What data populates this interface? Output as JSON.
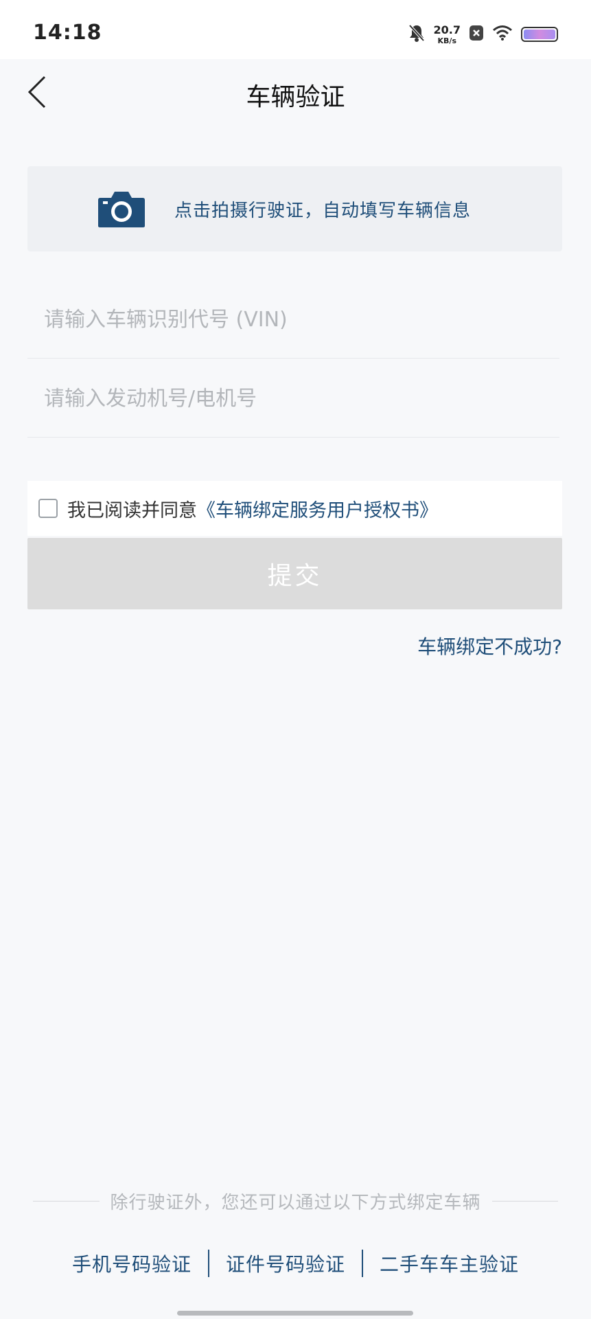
{
  "status_bar": {
    "time": "14:18",
    "net_speed_value": "20.7",
    "net_speed_unit": "KB/s",
    "icons": [
      "bell-off-icon",
      "close-notification-icon",
      "wifi-icon",
      "battery-icon"
    ]
  },
  "nav": {
    "title": "车辆验证",
    "back_icon": "chevron-left-icon"
  },
  "photo_card": {
    "icon": "camera-icon",
    "text": "点击拍摄行驶证，自动填写车辆信息"
  },
  "form": {
    "vin": {
      "placeholder": "请输入车辆识别代号 (VIN)",
      "value": ""
    },
    "engine": {
      "placeholder": "请输入发动机号/电机号",
      "value": ""
    }
  },
  "agreement": {
    "checked": false,
    "prefix": "我已阅读并同意",
    "link": "《车辆绑定服务用户授权书》"
  },
  "submit": {
    "label": "提交",
    "enabled": false
  },
  "help_link": "车辆绑定不成功?",
  "alt_section": {
    "divider_text": "除行驶证外，您还可以通过以下方式绑定车辆",
    "methods": [
      "手机号码验证",
      "证件号码验证",
      "二手车车主验证"
    ]
  },
  "colors": {
    "accent": "#1f4e79",
    "background": "#f7f8fa",
    "card": "#eef0f3",
    "disabled_button": "#dcdcdc"
  }
}
